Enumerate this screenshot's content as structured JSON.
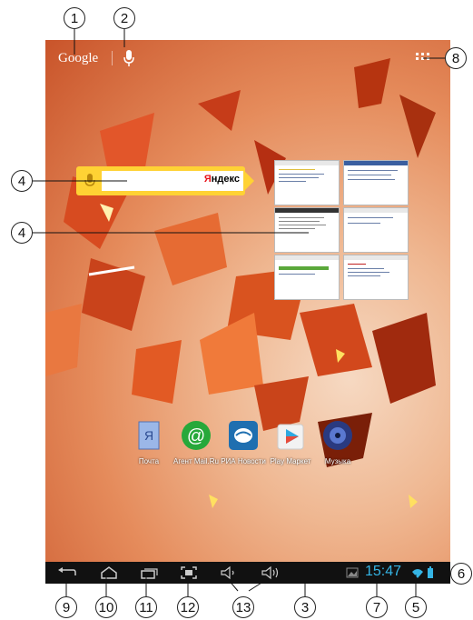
{
  "topbar": {
    "search_brand": "Google",
    "mic_icon": "microphone-icon",
    "apps_icon": "all-apps-grid-icon"
  },
  "yandex_widget": {
    "logo_prefix": "Я",
    "logo_rest": "ндекс",
    "input_value": ""
  },
  "apps": [
    {
      "label": "Почта",
      "icon": "mail-app-icon"
    },
    {
      "label": "Агент Mail.Ru",
      "icon": "mail-agent-icon"
    },
    {
      "label": "РИА Новости",
      "icon": "ria-news-icon"
    },
    {
      "label": "Play Маркет",
      "icon": "play-market-icon"
    },
    {
      "label": "Музыка",
      "icon": "music-icon"
    }
  ],
  "navbar": {
    "clock": "15:47",
    "buttons": [
      "back-icon",
      "home-icon",
      "recent-apps-icon",
      "screenshot-icon",
      "volume-down-icon",
      "volume-up-icon"
    ]
  },
  "callouts": [
    "1",
    "2",
    "3",
    "4",
    "4",
    "5",
    "6",
    "7",
    "8",
    "9",
    "10",
    "11",
    "12",
    "13"
  ],
  "colors": {
    "accent": "#35b5e5",
    "yandex_yellow": "#ffd234",
    "yandex_red": "#e8141b",
    "navbar": "#111111"
  }
}
